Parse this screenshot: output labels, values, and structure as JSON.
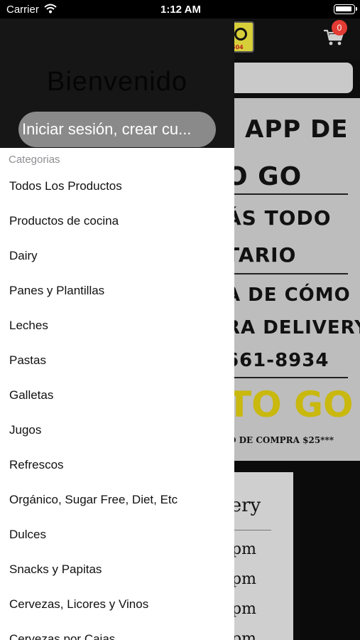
{
  "status_bar": {
    "carrier": "Carrier",
    "time": "1:12 AM"
  },
  "header_bg": {
    "logo_code": "504",
    "cart_count": "0"
  },
  "banner": {
    "line1": "APP DE",
    "line2": "O GO",
    "line3": "ÁS TODO",
    "line4": "TARIO",
    "line5": "A DE CÓMO",
    "line6": "RA DELIVERY,",
    "line7": "661-8934",
    "togo": "TO GO",
    "compra": "O DE COMPRA $25***"
  },
  "delivery_card": {
    "title": "very",
    "times": [
      "6pm",
      "6pm",
      "6pm",
      "6pm"
    ]
  },
  "drawer": {
    "welcome": "Bienvenido",
    "login_label": "Iniciar sesión, crear cu...",
    "categories_header": "Categorias",
    "categories": [
      "Todos Los Productos",
      "Productos de cocina",
      "Dairy",
      "Panes y Plantillas",
      "Leches",
      "Pastas",
      "Galletas",
      "Jugos",
      "Refrescos",
      "Orgánico, Sugar Free, Diet, Etc",
      "Dulces",
      "Snacks y Papitas",
      "Cervezas, Licores y Vinos",
      "Cervezas por Cajas"
    ]
  },
  "colors": {
    "accent_yellow": "#c9b80e",
    "badge_red": "#e23b33",
    "drawer_header": "#161616"
  }
}
